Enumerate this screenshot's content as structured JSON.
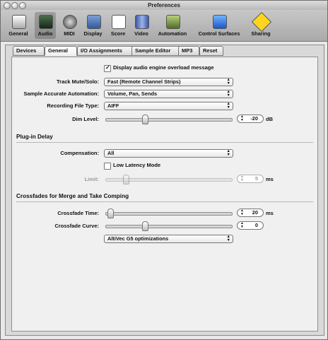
{
  "window": {
    "title": "Preferences"
  },
  "toolbar": [
    {
      "label": "General",
      "icon": "general-icon"
    },
    {
      "label": "Audio",
      "icon": "audio-icon"
    },
    {
      "label": "MIDI",
      "icon": "midi-icon"
    },
    {
      "label": "Display",
      "icon": "display-icon"
    },
    {
      "label": "Score",
      "icon": "score-icon"
    },
    {
      "label": "Video",
      "icon": "video-icon"
    },
    {
      "label": "Automation",
      "icon": "automation-icon"
    },
    {
      "label": "Control Surfaces",
      "icon": "control-surfaces-icon"
    },
    {
      "label": "Sharing",
      "icon": "sharing-icon"
    }
  ],
  "tabs": [
    "Devices",
    "General",
    "I/O Assignments",
    "Sample Editor",
    "MP3",
    "Reset"
  ],
  "general": {
    "display_overload": "Display audio engine overload message",
    "track_mute_solo_label": "Track Mute/Solo:",
    "track_mute_solo_value": "Fast (Remote Channel Strips)",
    "sample_accurate_label": "Sample Accurate Automation:",
    "sample_accurate_value": "Volume, Pan, Sends",
    "recording_file_type_label": "Recording File Type:",
    "recording_file_type_value": "AIFF",
    "dim_level_label": "Dim Level:",
    "dim_level_value": "-20",
    "dim_level_unit": "dB"
  },
  "plugin_delay": {
    "title": "Plug-in Delay",
    "compensation_label": "Compensation:",
    "compensation_value": "All",
    "low_latency_label": "Low Latency Mode",
    "limit_label": "Limit:",
    "limit_value": "5",
    "limit_unit": "ms"
  },
  "crossfades": {
    "title": "Crossfades for Merge and Take Comping",
    "time_label": "Crossfade Time:",
    "time_value": "20",
    "time_unit": "ms",
    "curve_label": "Crossfade Curve:",
    "curve_value": "0",
    "optimization_value": "AltiVec G5 optimizations"
  }
}
